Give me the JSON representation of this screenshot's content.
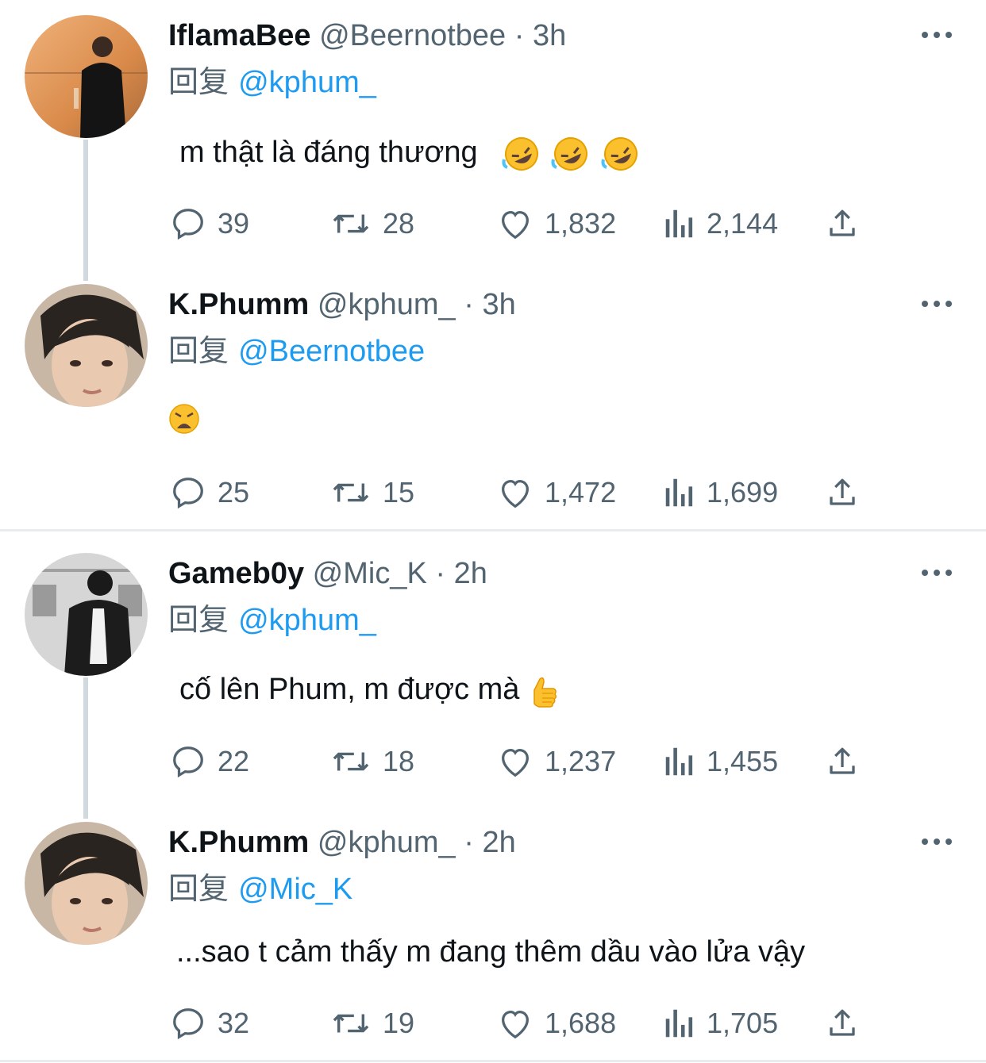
{
  "colors": {
    "accent": "#1d9bf0",
    "muted": "#536471",
    "text": "#0f1419",
    "divider": "#e6ecf0"
  },
  "tweets": [
    {
      "name": "IflamaBee",
      "handle": "@Beernotbee",
      "time": "3h",
      "reply_prefix": "回复",
      "reply_to": "@kphum_",
      "text": "m thật là đáng thương",
      "emoji": [
        "rolling-on-floor-laughing",
        "rolling-on-floor-laughing",
        "rolling-on-floor-laughing"
      ],
      "replies": "39",
      "retweets": "28",
      "likes": "1,832",
      "views": "2,144"
    },
    {
      "name": "K.Phumm",
      "handle": "@kphum_",
      "time": "3h",
      "reply_prefix": "回复",
      "reply_to": "@Beernotbee",
      "text": "",
      "emoji": [
        "weary-face"
      ],
      "replies": "25",
      "retweets": "15",
      "likes": "1,472",
      "views": "1,699"
    },
    {
      "name": "Gameb0y",
      "handle": "@Mic_K",
      "time": "2h",
      "reply_prefix": "回复",
      "reply_to": "@kphum_",
      "text": "cố lên Phum, m được mà",
      "emoji": [
        "thumbs-up"
      ],
      "replies": "22",
      "retweets": "18",
      "likes": "1,237",
      "views": "1,455"
    },
    {
      "name": "K.Phumm",
      "handle": "@kphum_",
      "time": "2h",
      "reply_prefix": "回复",
      "reply_to": "@Mic_K",
      "text": "...sao t cảm thấy m đang thêm dầu vào lửa vậy",
      "emoji": [],
      "replies": "32",
      "retweets": "19",
      "likes": "1,688",
      "views": "1,705"
    }
  ],
  "separator": "·"
}
